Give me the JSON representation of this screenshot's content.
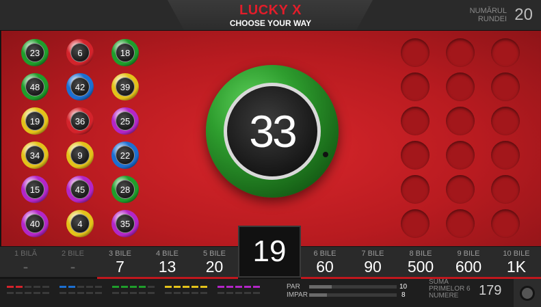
{
  "header": {
    "title": "LUCKY X",
    "subtitle": "CHOOSE YOUR WAY",
    "round_label": "NUMĂRUL RUNDEI",
    "round_value": "20"
  },
  "drawn_balls": [
    {
      "number": "23",
      "color": "#1f9e2b"
    },
    {
      "number": "6",
      "color": "#d3232b"
    },
    {
      "number": "18",
      "color": "#1f9e2b"
    },
    {
      "number": "48",
      "color": "#1f9e2b"
    },
    {
      "number": "42",
      "color": "#1c6fd1"
    },
    {
      "number": "39",
      "color": "#e3c21a"
    },
    {
      "number": "19",
      "color": "#e3c21a"
    },
    {
      "number": "36",
      "color": "#d3232b"
    },
    {
      "number": "25",
      "color": "#b326c7"
    },
    {
      "number": "34",
      "color": "#e3c21a"
    },
    {
      "number": "9",
      "color": "#e3c21a"
    },
    {
      "number": "22",
      "color": "#1c6fd1"
    },
    {
      "number": "15",
      "color": "#b326c7"
    },
    {
      "number": "45",
      "color": "#b326c7"
    },
    {
      "number": "28",
      "color": "#1f9e2b"
    },
    {
      "number": "40",
      "color": "#b326c7"
    },
    {
      "number": "4",
      "color": "#e3c21a"
    },
    {
      "number": "35",
      "color": "#b326c7"
    }
  ],
  "empty_slots": 18,
  "current_ball": {
    "number": "33",
    "color": "#2e9d2e"
  },
  "center_counter": "19",
  "payouts_left": [
    {
      "label": "1 BILĂ",
      "value": "-",
      "active": false
    },
    {
      "label": "2 BILE",
      "value": "-",
      "active": false
    },
    {
      "label": "3 BILE",
      "value": "7",
      "active": true
    },
    {
      "label": "4 BILE",
      "value": "13",
      "active": true
    },
    {
      "label": "5 BILE",
      "value": "20",
      "active": true
    }
  ],
  "payouts_right": [
    {
      "label": "6 BILE",
      "value": "60",
      "active": true
    },
    {
      "label": "7 BILE",
      "value": "90",
      "active": true
    },
    {
      "label": "8 BILE",
      "value": "500",
      "active": true
    },
    {
      "label": "9 BILE",
      "value": "600",
      "active": true
    },
    {
      "label": "10 BILE",
      "value": "1K",
      "active": true
    }
  ],
  "color_stats": [
    {
      "color": "#d3232b",
      "lit": 2
    },
    {
      "color": "#1c6fd1",
      "lit": 2
    },
    {
      "color": "#1f9e2b",
      "lit": 4
    },
    {
      "color": "#e3c21a",
      "lit": 5
    },
    {
      "color": "#b326c7",
      "lit": 5
    }
  ],
  "parity": {
    "par_label": "PAR",
    "par_value": "10",
    "par_fraction": 0.26,
    "impar_label": "IMPAR",
    "impar_value": "8",
    "impar_fraction": 0.2
  },
  "sum": {
    "label": "SUMA PRIMELOR 6 NUMERE",
    "value": "179"
  },
  "colors": {
    "board": "#c41e24",
    "accent": "#e21d2a"
  }
}
